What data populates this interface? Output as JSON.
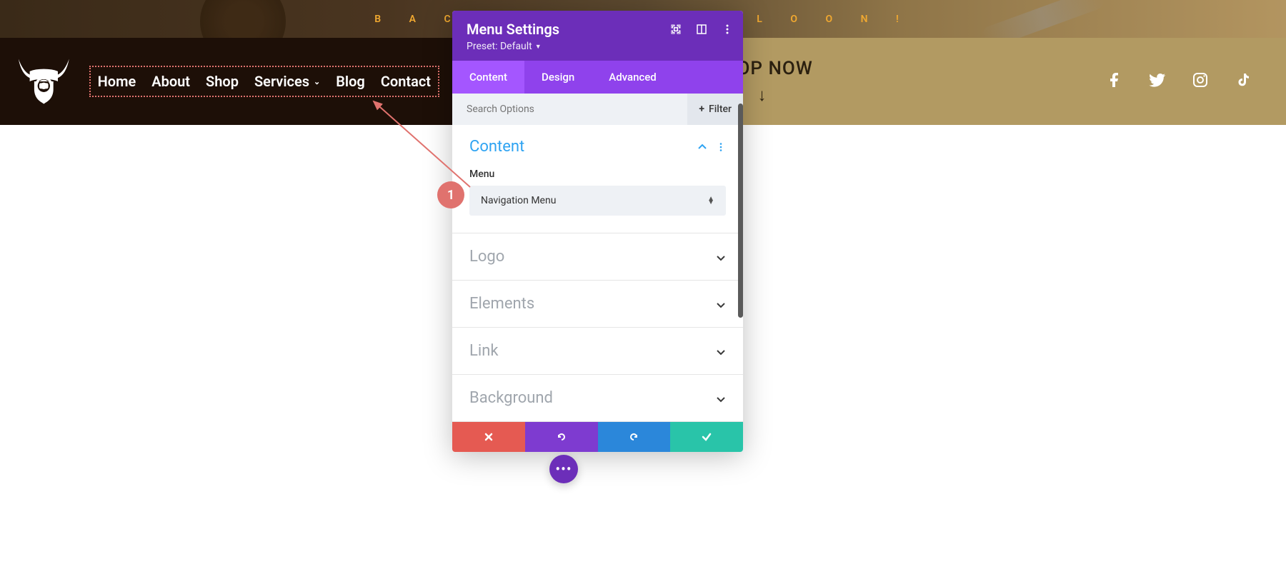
{
  "banner": {
    "text": "B A C K   T O   S C H O O L   O O N !"
  },
  "nav": {
    "items": [
      {
        "label": "Home"
      },
      {
        "label": "About"
      },
      {
        "label": "Shop"
      },
      {
        "label": "Services",
        "has_submenu": true
      },
      {
        "label": "Blog"
      },
      {
        "label": "Contact"
      }
    ]
  },
  "cta": {
    "label": "SHOP NOW",
    "arrow": "↓"
  },
  "social": [
    "facebook",
    "twitter",
    "instagram",
    "tiktok"
  ],
  "panel": {
    "title": "Menu Settings",
    "preset_label": "Preset: Default",
    "tabs": [
      "Content",
      "Design",
      "Advanced"
    ],
    "active_tab": "Content",
    "search_placeholder": "Search Options",
    "filter_label": "Filter",
    "open_section": {
      "title": "Content",
      "field_label": "Menu",
      "select_value": "Navigation Menu"
    },
    "closed_sections": [
      "Logo",
      "Elements",
      "Link",
      "Background"
    ]
  },
  "annotation": {
    "badge": "1"
  },
  "colors": {
    "purple_dark": "#6c2eb9",
    "purple_mid": "#8f42ec",
    "purple_light": "#a456ff",
    "accent_blue": "#2ea3f2",
    "danger": "#e55a52",
    "info": "#2b87da",
    "success": "#29c4a9",
    "brown_dark": "#1d0f07",
    "gold": "#b29a62",
    "coral": "#e0726e"
  }
}
